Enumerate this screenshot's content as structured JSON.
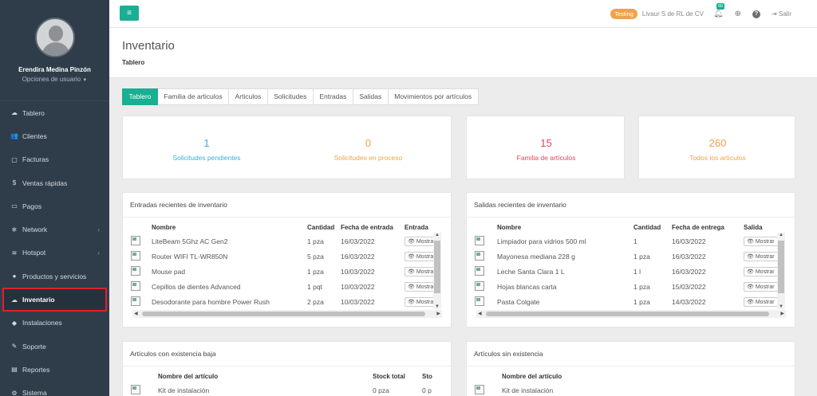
{
  "user": {
    "name": "Erendira Medina Pinzón",
    "options": "Opciones de usuario"
  },
  "menu": [
    {
      "icon": "☁",
      "label": "Tablero"
    },
    {
      "icon": "👥",
      "label": "Clientes"
    },
    {
      "icon": "▢",
      "label": "Facturas"
    },
    {
      "icon": "$",
      "label": "Ventas rápidas"
    },
    {
      "icon": "▭",
      "label": "Pagos"
    },
    {
      "icon": "❄",
      "label": "Network",
      "arrow": "‹"
    },
    {
      "icon": "≋",
      "label": "Hotspot",
      "arrow": "‹"
    },
    {
      "icon": "●",
      "label": "Productos y servicios"
    },
    {
      "icon": "☁",
      "label": "Inventario"
    },
    {
      "icon": "◆",
      "label": "Instalaciones"
    },
    {
      "icon": "✎",
      "label": "Soporte"
    },
    {
      "icon": "▤",
      "label": "Reportes"
    },
    {
      "icon": "⚙",
      "label": "Sistema"
    }
  ],
  "topbar": {
    "menu_icon": "≡",
    "env": "Testing",
    "company": "Livaur S de RL de CV",
    "notifications": "60",
    "logout": "Salir"
  },
  "page": {
    "title": "Inventario",
    "subtitle": "Tablero"
  },
  "tabs": [
    "Tablero",
    "Familia de articulos",
    "Articulos",
    "Solicitudes",
    "Entradas",
    "Salidas",
    "Movimientos por artículos"
  ],
  "stats": {
    "pending": {
      "value": "1",
      "label": "Solicitudes pendientes"
    },
    "in_process": {
      "value": "0",
      "label": "Solicitudes en proceso"
    },
    "families": {
      "value": "15",
      "label": "Familia de artículos"
    },
    "articles": {
      "value": "260",
      "label": "Todos los artículos"
    }
  },
  "entradas": {
    "title": "Entradas recientes de inventario",
    "headers": [
      "Nombre",
      "Cantidad",
      "Fecha de entrada",
      "Entrada"
    ],
    "rows": [
      [
        "LiteBeam 5Ghz AC Gen2",
        "1 pza",
        "16/03/2022",
        "Mostrar"
      ],
      [
        "Router WIFI TL-WR850N",
        "5 pza",
        "16/03/2022",
        "Mostrar"
      ],
      [
        "Mouse pad",
        "1 pza",
        "10/03/2022",
        "Mostrar"
      ],
      [
        "Cepillos de dientes Advanced",
        "1 pqt",
        "10/03/2022",
        "Mostrar"
      ],
      [
        "Desodorante para hombre Power Rush",
        "2 pza",
        "10/03/2022",
        "Mostrar"
      ]
    ]
  },
  "salidas": {
    "title": "Salidas recientes de inventario",
    "headers": [
      "Nombre",
      "Cantidad",
      "Fecha de entrega",
      "Salida"
    ],
    "rows": [
      [
        "Limpiador para vidrios 500 ml",
        "1",
        "16/03/2022",
        "Mostrar"
      ],
      [
        "Mayonesa mediana 228 g",
        "1 pza",
        "16/03/2022",
        "Mostrar"
      ],
      [
        "Leche Santa Clara 1 L",
        "1 l",
        "16/03/2022",
        "Mostrar"
      ],
      [
        "Hojas blancas carta",
        "1 pza",
        "15/03/2022",
        "Mostrar"
      ],
      [
        "Pasta Colgate",
        "1 pza",
        "14/03/2022",
        "Mostrar"
      ]
    ]
  },
  "baja": {
    "title": "Artículos con existencia baja",
    "headers": [
      "Nombre del artículo",
      "Stock total",
      "Sto"
    ],
    "rows": [
      [
        "Kit de instalación",
        "0 pza",
        "0 p"
      ]
    ]
  },
  "sin": {
    "title": "Artículos sin existencia",
    "headers": [
      "Nombre del artículo"
    ],
    "rows": [
      [
        "Kit de instalación"
      ]
    ]
  }
}
